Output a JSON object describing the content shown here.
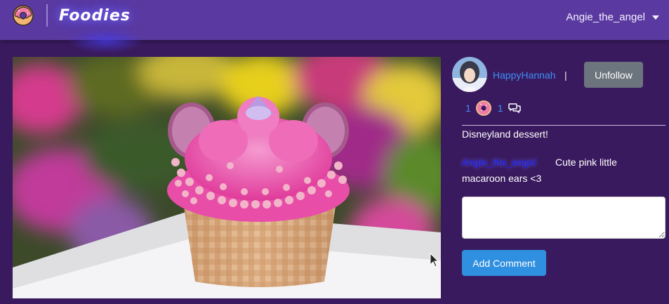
{
  "navbar": {
    "brand": "Foodies",
    "username": "Angie_the_angel",
    "bg_color": "#5a3aa0"
  },
  "post": {
    "author": "HappyHannah",
    "separator": "|",
    "follow_button_label": "Unfollow",
    "likes_count": "1",
    "comments_count": "1",
    "caption": "Disneyland dessert!",
    "image_alt": "pink cupcake with macaroon ears"
  },
  "comments": [
    {
      "user": "Angie_the_angel",
      "text": "Cute pink little macaroon ears <3"
    }
  ],
  "comment_form": {
    "input_value": "",
    "submit_label": "Add Comment"
  },
  "colors": {
    "page_bg": "#3a1a5e",
    "link": "#3d8ff5",
    "secondary_button": "#6c757d",
    "primary_button": "#2f8fe0"
  },
  "icons": [
    "donut-logo-icon",
    "caret-down-icon",
    "donut-like-icon",
    "chat-icon",
    "mouse-cursor-icon"
  ]
}
